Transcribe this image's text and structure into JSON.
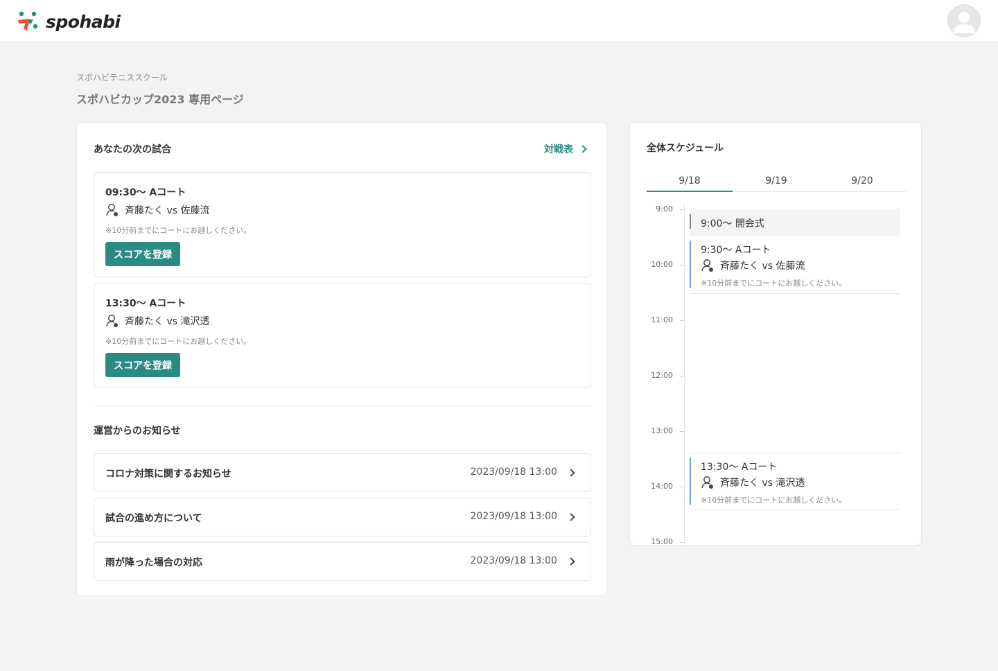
{
  "header": {
    "logo_text": "spohabi"
  },
  "org_name": "スポハビテニススクール",
  "page_title": "スポハビカップ2023 専用ページ",
  "next_match": {
    "title": "あなたの次の試合",
    "link_label": "対戦表",
    "matches": [
      {
        "time": "09:30〜  Aコート",
        "players": "斉藤たく vs 佐藤流",
        "note": "※10分前までにコートにお越しください。",
        "button": "スコアを登録"
      },
      {
        "time": "13:30〜  Aコート",
        "players": "斉藤たく vs 滝沢透",
        "note": "※10分前までにコートにお越しください。",
        "button": "スコアを登録"
      }
    ]
  },
  "notices": {
    "title": "運営からのお知らせ",
    "items": [
      {
        "title": "コロナ対策に関するお知らせ",
        "date": "2023/09/18 13:00"
      },
      {
        "title": "試合の進め方について",
        "date": "2023/09/18 13:00"
      },
      {
        "title": "雨が降った場合の対応",
        "date": "2023/09/18 13:00"
      }
    ]
  },
  "schedule": {
    "title": "全体スケジュール",
    "tabs": [
      "9/18",
      "9/19",
      "9/20"
    ],
    "active_tab": 0,
    "hours": [
      "9:00",
      "10:00",
      "11:00",
      "12:00",
      "13:00",
      "14:00",
      "15:00"
    ],
    "events": {
      "ceremony": {
        "title": "9:00〜  開会式"
      },
      "match1": {
        "title": "9:30〜  Aコート",
        "players": "斉藤たく vs 佐藤流",
        "note": "※10分前までにコートにお越しください。"
      },
      "match2": {
        "title": "13:30〜  Aコート",
        "players": "斉藤たく vs 滝沢透",
        "note": "※10分前までにコートにお越しください。"
      }
    }
  },
  "colors": {
    "accent": "#2b8a84",
    "event_bar": "#6f9fe0",
    "ceremony_bar": "#888888"
  }
}
